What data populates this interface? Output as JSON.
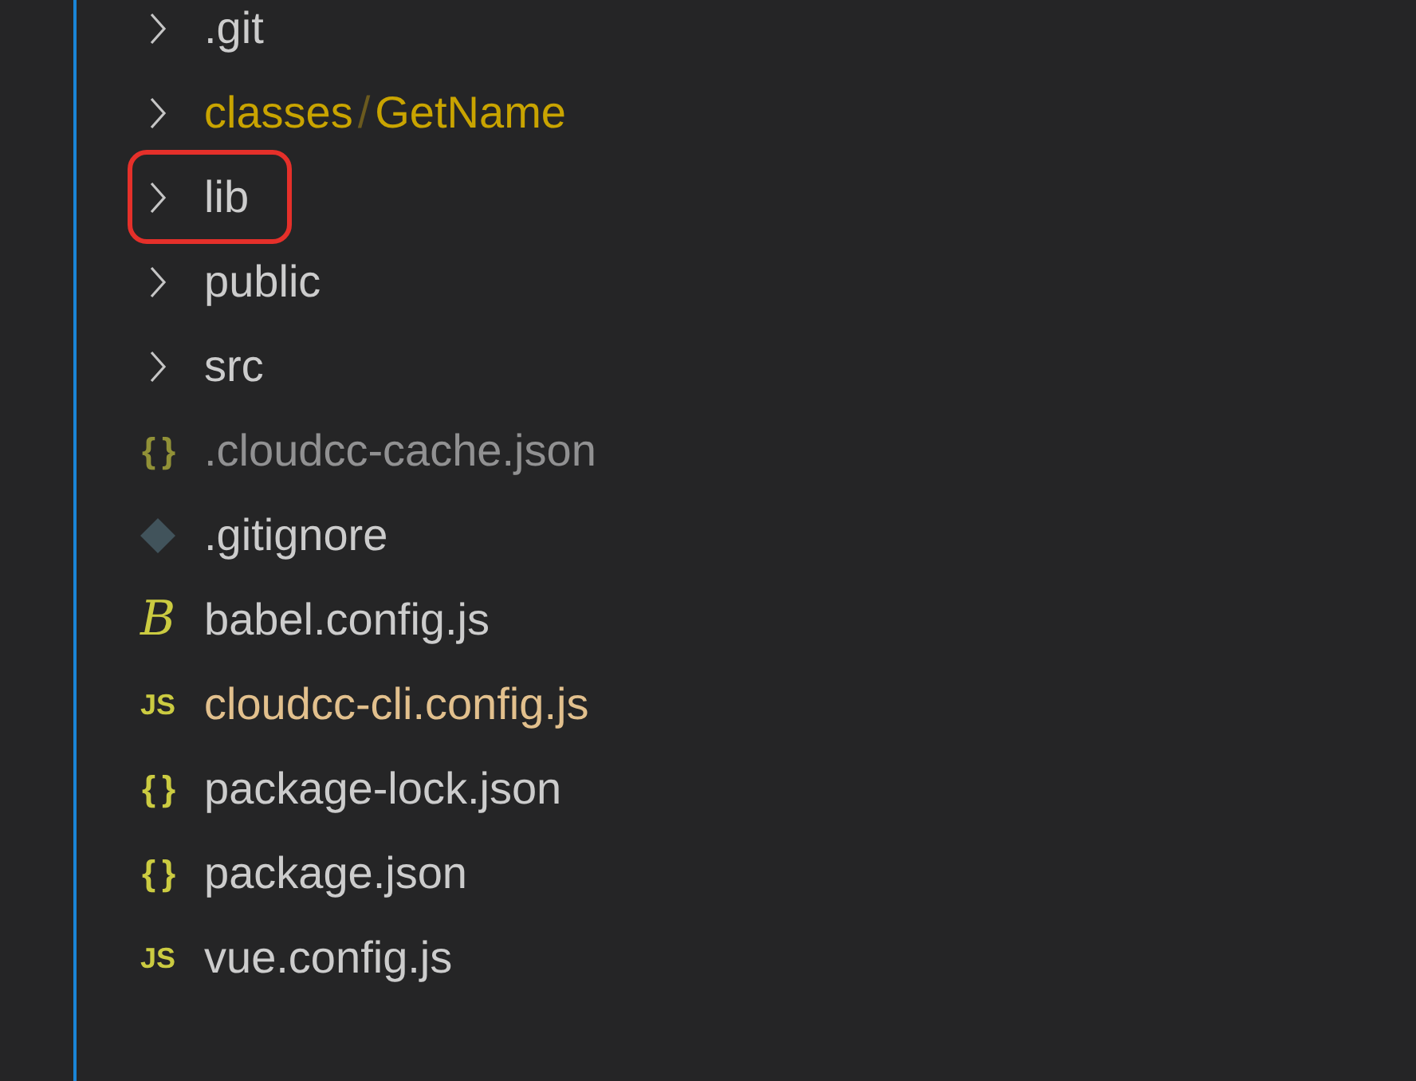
{
  "items": [
    {
      "kind": "folder",
      "label": ".git",
      "problems": false,
      "ignored": false,
      "modified": false,
      "highlighted": false
    },
    {
      "kind": "folder",
      "segments": [
        "classes",
        "GetName"
      ],
      "separator": "/",
      "problems": true,
      "ignored": false,
      "modified": false,
      "highlighted": false
    },
    {
      "kind": "folder",
      "label": "lib",
      "problems": false,
      "ignored": false,
      "modified": false,
      "highlighted": true
    },
    {
      "kind": "folder",
      "label": "public",
      "problems": false,
      "ignored": false,
      "modified": false,
      "highlighted": false
    },
    {
      "kind": "folder",
      "label": "src",
      "problems": false,
      "ignored": false,
      "modified": false,
      "highlighted": false
    },
    {
      "kind": "json",
      "icon_text": "{ }",
      "label": ".cloudcc-cache.json",
      "problems": false,
      "ignored": true,
      "modified": false,
      "highlighted": false
    },
    {
      "kind": "git",
      "label": ".gitignore",
      "problems": false,
      "ignored": false,
      "modified": false,
      "highlighted": false
    },
    {
      "kind": "babel",
      "icon_text": "B",
      "label": "babel.config.js",
      "problems": false,
      "ignored": false,
      "modified": false,
      "highlighted": false
    },
    {
      "kind": "js",
      "icon_text": "JS",
      "label": "cloudcc-cli.config.js",
      "problems": false,
      "ignored": false,
      "modified": true,
      "highlighted": false
    },
    {
      "kind": "json",
      "icon_text": "{ }",
      "label": "package-lock.json",
      "problems": false,
      "ignored": false,
      "modified": false,
      "highlighted": false
    },
    {
      "kind": "json",
      "icon_text": "{ }",
      "label": "package.json",
      "problems": false,
      "ignored": false,
      "modified": false,
      "highlighted": false
    },
    {
      "kind": "js",
      "icon_text": "JS",
      "label": "vue.config.js",
      "problems": false,
      "ignored": false,
      "modified": false,
      "highlighted": false
    }
  ]
}
